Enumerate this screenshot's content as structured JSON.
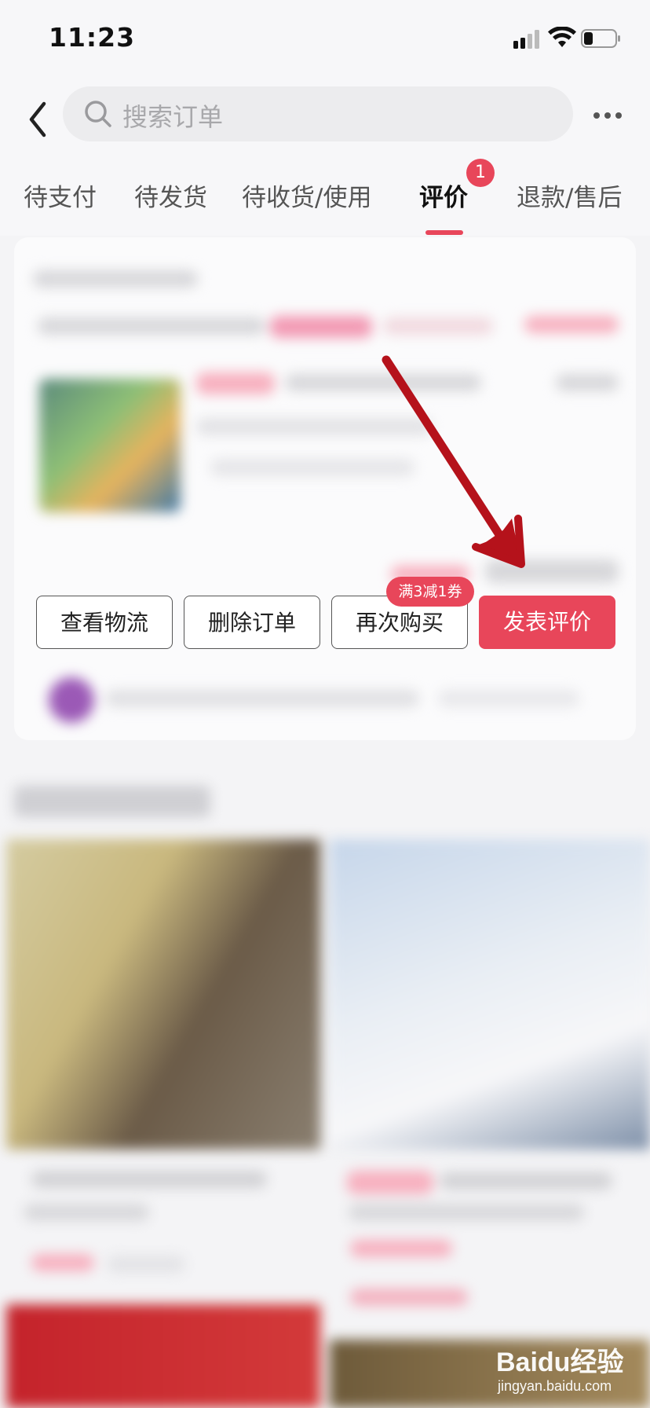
{
  "status_bar": {
    "time": "11:23"
  },
  "header": {
    "search_placeholder": "搜索订单",
    "tabs": [
      {
        "label": "待支付"
      },
      {
        "label": "待发货"
      },
      {
        "label": "待收货/使用"
      },
      {
        "label": "评价",
        "badge": "1",
        "active": true
      },
      {
        "label": "退款/售后"
      }
    ]
  },
  "order": {
    "actions": {
      "logistics": "查看物流",
      "delete": "删除订单",
      "rebuy": "再次购买",
      "review": "发表评价"
    },
    "coupon_tag": "满3减1券"
  },
  "watermark": {
    "logo": "Baidu经验",
    "url": "jingyan.baidu.com"
  },
  "colors": {
    "accent": "#e8465a",
    "arrow": "#b5121b"
  },
  "icons": [
    "back-arrow-icon",
    "search-icon",
    "more-dots-icon",
    "signal-icon",
    "wifi-icon",
    "battery-icon"
  ]
}
